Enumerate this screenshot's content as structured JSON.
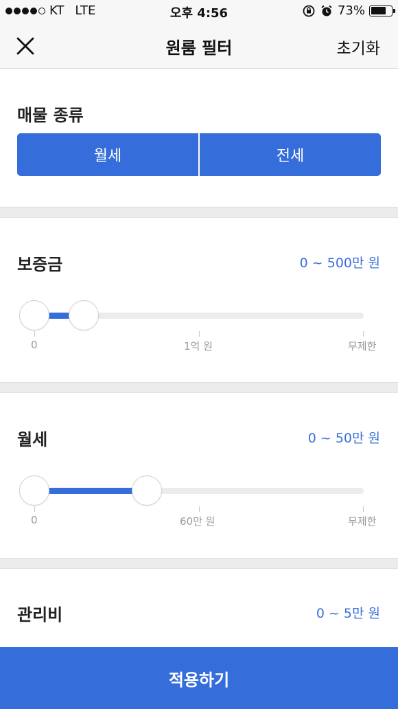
{
  "status_bar": {
    "carrier": "KT",
    "network": "LTE",
    "time": "오후 4:56",
    "battery": "73%",
    "battery_level": 0.73,
    "icons": [
      "signal-dots-icon",
      "orientation-lock-icon",
      "alarm-icon",
      "battery-icon"
    ]
  },
  "nav": {
    "title": "원룸 필터",
    "reset_label": "초기화",
    "close_icon": "close-icon"
  },
  "property_type": {
    "title": "매물 종류",
    "options": [
      "월세",
      "전세"
    ]
  },
  "deposit": {
    "title": "보증금",
    "range_text": "0 ~ 500만 원",
    "tick_labels": [
      "0",
      "1억 원",
      "무제한"
    ],
    "slider_low": 0,
    "slider_high": 0.08
  },
  "monthly_rent": {
    "title": "월세",
    "range_text": "0 ~ 50만 원",
    "tick_labels": [
      "0",
      "60만 원",
      "무제한"
    ],
    "slider_low": 0,
    "slider_high": 0.27
  },
  "maintenance_fee": {
    "title": "관리비",
    "range_text": "0 ~ 5만 원"
  },
  "apply_label": "적용하기",
  "colors": {
    "accent": "#356ddb",
    "range_text": "#3a6fd8",
    "track": "#ececec",
    "bar_bg": "#f7f7f7"
  }
}
